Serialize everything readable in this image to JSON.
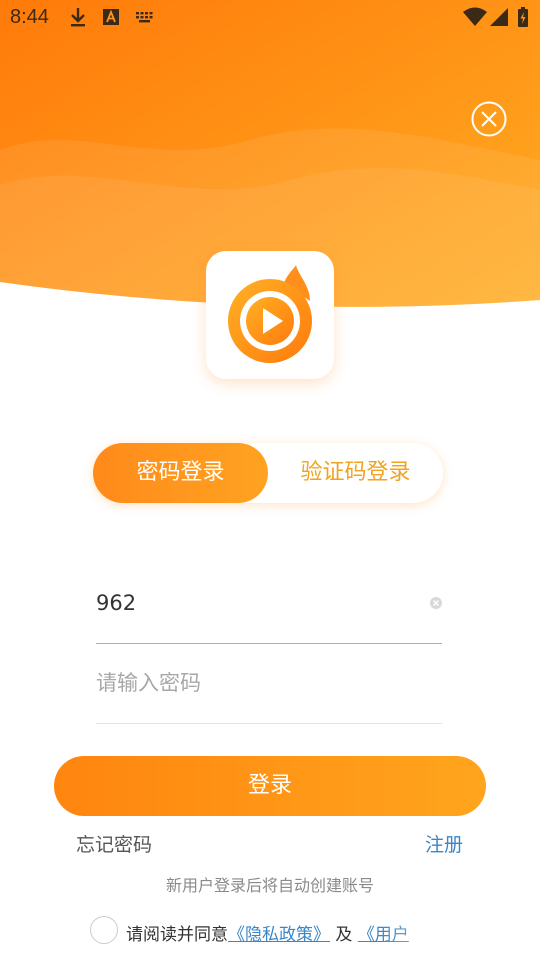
{
  "status_bar": {
    "time": "8:44",
    "left_icons": [
      "download-icon",
      "font-a-icon",
      "keyboard-icon"
    ],
    "right_icons": [
      "wifi-icon",
      "signal-icon",
      "battery-charging-icon"
    ]
  },
  "colors": {
    "accent_start": "#ff850f",
    "accent_end": "#ffa51d",
    "link": "#3a86c8",
    "tab_inactive_text": "#f0a320"
  },
  "tabs": [
    {
      "label": "密码登录",
      "active": true
    },
    {
      "label": "验证码登录",
      "active": false
    }
  ],
  "form": {
    "username_value": "962",
    "password_placeholder": "请输入密码"
  },
  "login_button": "登录",
  "links": {
    "forgot": "忘记密码",
    "register": "注册"
  },
  "hint": "新用户登录后将自动创建账号",
  "agreement": {
    "prefix": "请阅读并同意",
    "privacy": "《隐私政策》",
    "joiner": " 及 ",
    "user": "《用户"
  }
}
